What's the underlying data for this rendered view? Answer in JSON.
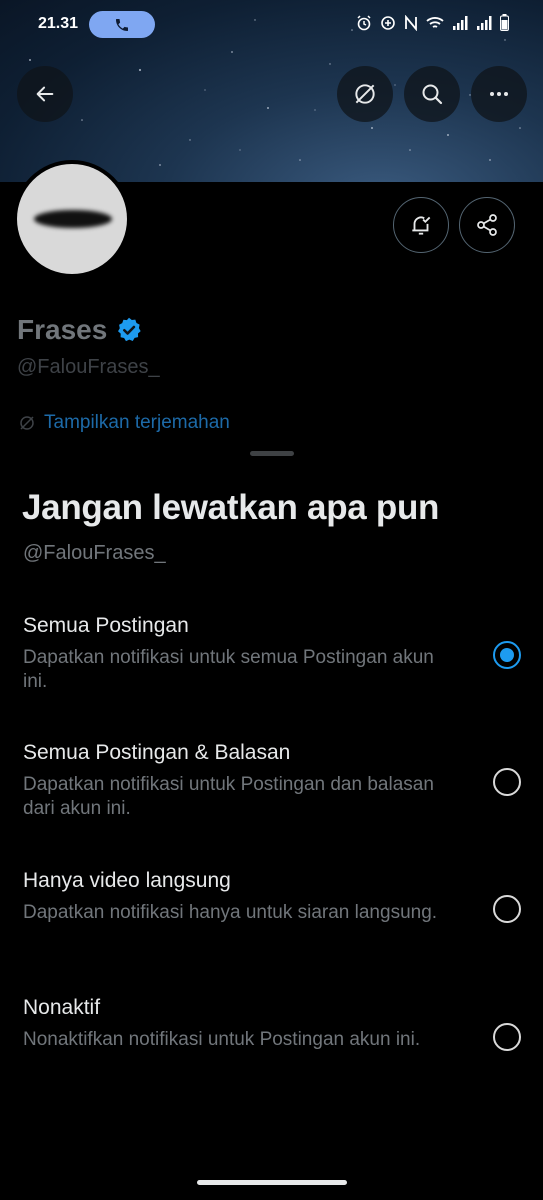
{
  "status_bar": {
    "time": "21.31",
    "icons": [
      "alarm-icon",
      "data-saver-icon",
      "nfc-icon",
      "wifi-icon",
      "signal-icon",
      "signal-icon",
      "battery-icon"
    ]
  },
  "header": {
    "back_icon": "arrow-left-icon",
    "translate_icon": "translate-off-icon",
    "search_icon": "search-icon",
    "more_icon": "more-horizontal-icon"
  },
  "profile": {
    "display_name": "Frases",
    "verified": true,
    "handle": "@FalouFrases_",
    "translate_link": "Tampilkan terjemahan"
  },
  "sheet": {
    "title": "Jangan lewatkan apa pun",
    "handle": "@FalouFrases_",
    "options": [
      {
        "title": "Semua Postingan",
        "description": "Dapatkan notifikasi untuk semua Postingan akun ini.",
        "selected": true
      },
      {
        "title": "Semua Postingan & Balasan",
        "description": "Dapatkan notifikasi untuk Postingan dan balasan dari akun ini.",
        "selected": false
      },
      {
        "title": "Hanya video langsung",
        "description": "Dapatkan notifikasi hanya untuk siaran langsung.",
        "selected": false
      },
      {
        "title": "Nonaktif",
        "description": "Nonaktifkan notifikasi untuk Postingan akun ini.",
        "selected": false
      }
    ]
  },
  "colors": {
    "accent": "#1d9bf0",
    "background": "#000000",
    "primary_text": "#e7e9ea",
    "secondary_text": "#71767b",
    "call_pill": "#7fa7f2"
  }
}
